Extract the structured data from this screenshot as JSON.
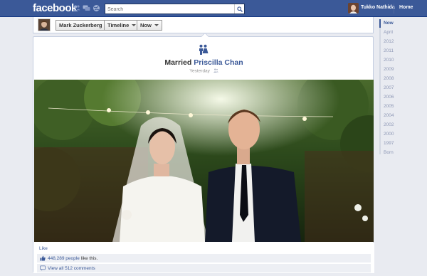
{
  "topbar": {
    "logo": "facebook",
    "search_placeholder": "Search",
    "user_name": "Tukko Nathida",
    "home_label": "Home"
  },
  "timeline_bar": {
    "profile_name": "Mark Zuckerberg",
    "timeline_label": "Timeline",
    "now_label": "Now"
  },
  "post": {
    "event_prefix": "Married",
    "event_partner": "Priscilla Chan",
    "timestamp": "Yesterday",
    "like_link": "Like",
    "likes_count": "448,289 people",
    "likes_suffix": "like this.",
    "comments_link": "View all 512 comments"
  },
  "scrubber": {
    "items": [
      "Now",
      "April",
      "2012",
      "2011",
      "2010",
      "2009",
      "2008",
      "2007",
      "2006",
      "2005",
      "2004",
      "2002",
      "2000",
      "1997",
      "Born"
    ]
  },
  "colors": {
    "brand": "#3b5998",
    "background": "#e9ebf1",
    "link": "#3b5998"
  },
  "icons": {
    "friends": "friends-icon",
    "messages": "messages-icon",
    "notifications": "globe-icon",
    "search": "search-icon",
    "life_event": "married-couple-icon",
    "audience": "audience-icon",
    "like_thumb": "thumbs-up-icon",
    "comment": "comment-icon"
  }
}
